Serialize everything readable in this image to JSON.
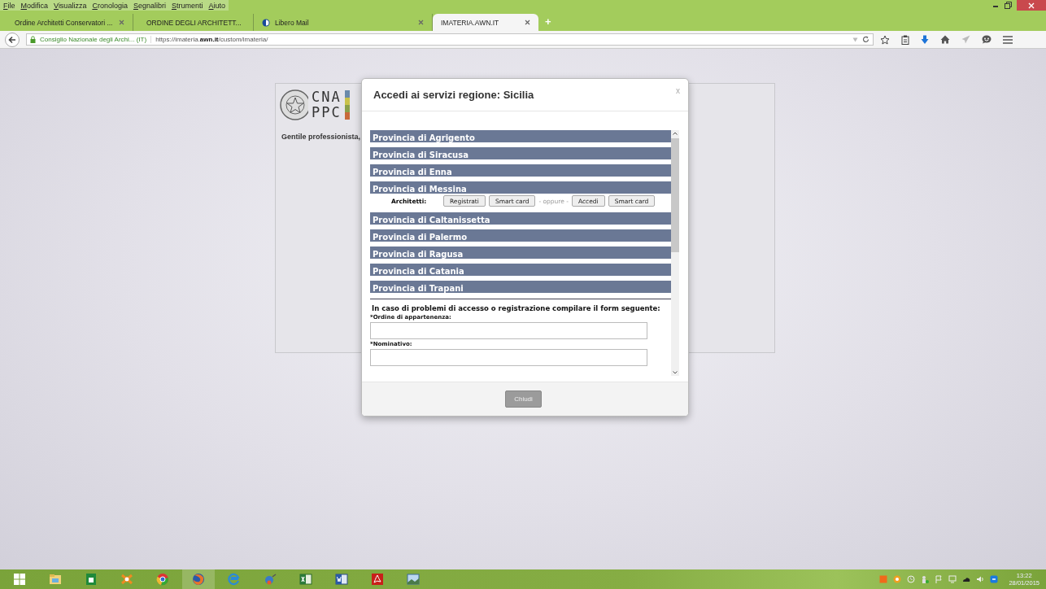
{
  "menu": [
    "File",
    "Modifica",
    "Visualizza",
    "Cronologia",
    "Segnalibri",
    "Strumenti",
    "Aiuto"
  ],
  "tabs": [
    {
      "label": "Ordine Architetti Conservatori ...",
      "selected": false
    },
    {
      "label": "ORDINE DEGLI ARCHITETT...",
      "selected": false
    },
    {
      "label": "Libero Mail",
      "selected": false
    },
    {
      "label": "IMATERIA.AWN.IT",
      "selected": true
    }
  ],
  "new_tab": "+",
  "address": {
    "site": "Consiglio Nazionale degli Archi... (IT)",
    "url": "https://imateria.**awn.it**/custom/imateria/"
  },
  "page": {
    "logo_top": "CNA",
    "logo_bottom": "PPC",
    "greeting": "Gentile professionista,"
  },
  "modal": {
    "title": "Accedi ai servizi regione: Sicilia",
    "close": "x",
    "provinces": [
      {
        "name": "Provincia di Agrigento"
      },
      {
        "name": "Provincia di Siracusa"
      },
      {
        "name": "Provincia di Enna"
      },
      {
        "name": "Provincia di Messina",
        "access": {
          "label": "Architetti:",
          "register": "Registrati",
          "smart_card_1": "Smart card",
          "or": "- oppure -",
          "login": "Accedi",
          "smart_card_2": "Smart card"
        }
      },
      {
        "name": "Provincia di Caltanissetta"
      },
      {
        "name": "Provincia di Palermo"
      },
      {
        "name": "Provincia di Ragusa"
      },
      {
        "name": "Provincia di Catania"
      },
      {
        "name": "Provincia di Trapani"
      }
    ],
    "help_text": "In caso di problemi di accesso o registrazione compilare il form seguente:",
    "fields": [
      {
        "label": "*Ordine di appartenenza:"
      },
      {
        "label": "*Nominativo:"
      }
    ],
    "close_button": "Chiudi"
  },
  "clock": {
    "time": "13:22",
    "date": "28/01/2015"
  }
}
